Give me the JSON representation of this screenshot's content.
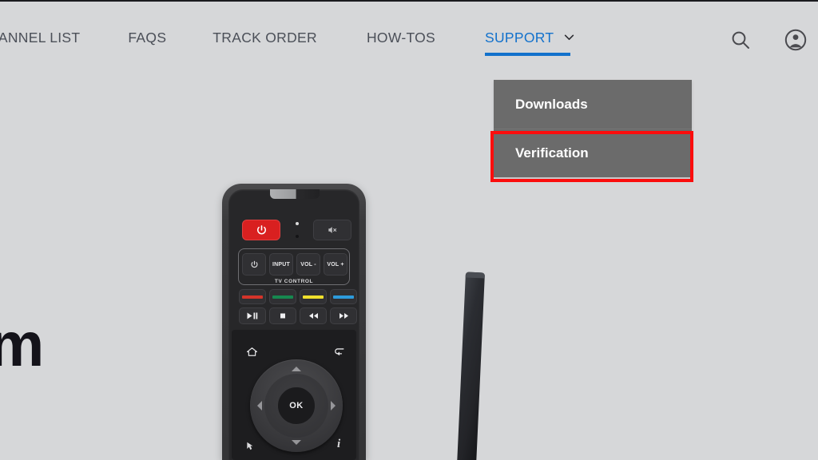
{
  "page": {
    "background_color": "#d6d7d9",
    "hero_heading_fragment": "m"
  },
  "header": {
    "nav_items": [
      {
        "label": "CHANNEL LIST",
        "active": false
      },
      {
        "label": "FAQS",
        "active": false
      },
      {
        "label": "TRACK ORDER",
        "active": false
      },
      {
        "label": "HOW-TOS",
        "active": false
      },
      {
        "label": "SUPPORT",
        "active": true,
        "has_chevron": true,
        "chevron_icon": "chevron-down-icon"
      }
    ],
    "active_color": "#1271cc",
    "inactive_color": "#4b4f58",
    "icons": [
      {
        "name": "search-icon",
        "label": "Search"
      },
      {
        "name": "account-circle-icon",
        "label": "Account"
      }
    ]
  },
  "dropdown": {
    "parent": "SUPPORT",
    "background_color": "#6b6b6b",
    "text_color": "#ffffff",
    "items": [
      {
        "label": "Downloads",
        "highlighted": false
      },
      {
        "label": "Verification",
        "highlighted": true
      }
    ],
    "highlight_color": "#fb0d0d"
  },
  "product": {
    "remote": {
      "power_button": {
        "icon": "power-icon",
        "color": "#d92020"
      },
      "mute_button": {
        "icon": "mute-icon"
      },
      "tv_control": {
        "group_label": "TV CONTROL",
        "buttons": [
          {
            "label": "",
            "icon": "power-icon"
          },
          {
            "label": "INPUT",
            "icon": ""
          },
          {
            "label": "VOL -",
            "icon": ""
          },
          {
            "label": "VOL +",
            "icon": ""
          }
        ]
      },
      "color_buttons": [
        {
          "name": "red-color-button",
          "color": "#d4342a"
        },
        {
          "name": "green-color-button",
          "color": "#16884f"
        },
        {
          "name": "yellow-color-button",
          "color": "#efe02c"
        },
        {
          "name": "blue-color-button",
          "color": "#2d9bdb"
        }
      ],
      "media_buttons": [
        {
          "name": "play-pause-button",
          "glyph": "▶❙❙"
        },
        {
          "name": "stop-button",
          "glyph": "■"
        },
        {
          "name": "rewind-button",
          "glyph": "◀◀"
        },
        {
          "name": "fast-forward-button",
          "glyph": "▶▶"
        }
      ],
      "nav_pad": {
        "ok_label": "OK",
        "home_icon": "home-icon",
        "back_icon": "back-arrow-icon",
        "mouse_icon": "mouse-pointer-icon",
        "info_label": "i"
      }
    },
    "antenna": {
      "name": "antenna-bar",
      "color": "#2b2d32"
    }
  }
}
